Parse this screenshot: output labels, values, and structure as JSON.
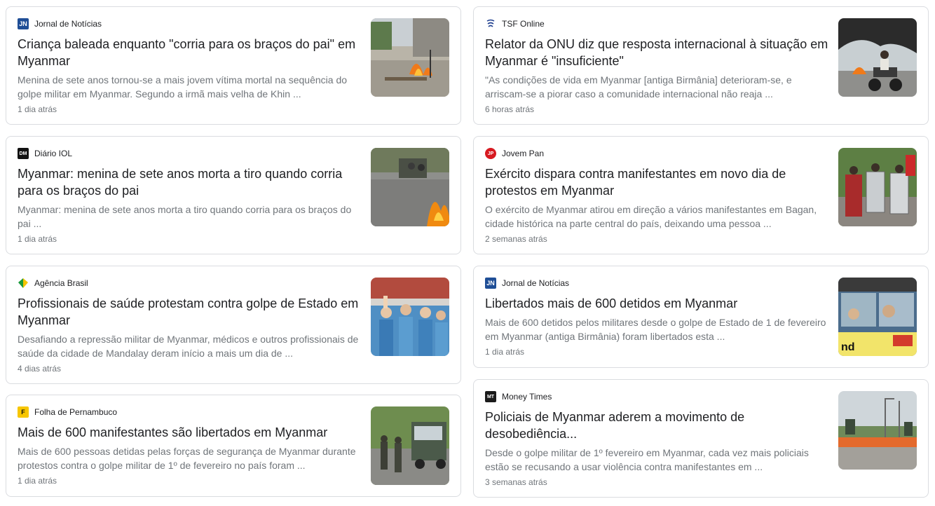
{
  "articles_left": [
    {
      "source": "Jornal de Notícias",
      "logo_text": "JN",
      "headline": "Criança baleada enquanto \"corria para os braços do pai\" em Myanmar",
      "snippet": "Menina de sete anos tornou-se a mais jovem vítima mortal na sequência do golpe militar em Myanmar. Segundo a irmã mais velha de Khin ...",
      "time": "1 dia atrás",
      "image_icon": "street-fire-photo"
    },
    {
      "source": "Diário IOL",
      "logo_text": "DM",
      "headline": "Myanmar: menina de sete anos morta a tiro quando corria para os braços do pai",
      "snippet": "Myanmar: menina de sete anos morta a tiro quando corria para os braços do pai ...",
      "time": "1 dia atrás",
      "image_icon": "street-burning-tire-photo"
    },
    {
      "source": "Agência Brasil",
      "logo_text": "",
      "headline": "Profissionais de saúde protestam contra golpe de Estado em Myanmar",
      "snippet": "Desafiando a repressão militar de Myanmar, médicos e outros profissionais de saúde da cidade de Mandalay deram início a mais um dia de ...",
      "time": "4 dias atrás",
      "image_icon": "health-workers-protest-photo"
    },
    {
      "source": "Folha de Pernambuco",
      "logo_text": "F",
      "headline": "Mais de 600 manifestantes são libertados em Myanmar",
      "snippet": "Mais de 600 pessoas detidas pelas forças de segurança de Myanmar durante protestos contra o golpe militar de 1º de fevereiro no país foram ...",
      "time": "1 dia atrás",
      "image_icon": "soldiers-truck-photo"
    }
  ],
  "articles_right": [
    {
      "source": "TSF Online",
      "logo_text": "",
      "headline": "Relator da ONU diz que resposta internacional à situação em Myanmar é \"insuficiente\"",
      "snippet": "\"As condições de vida em Myanmar [antiga Birmânia] deterioram-se, e arriscam-se a piorar caso a comunidade internacional não reaja ...",
      "time": "6 horas atrás",
      "image_icon": "motorbike-smoke-photo"
    },
    {
      "source": "Jovem Pan",
      "logo_text": "JP",
      "headline": "Exército dispara contra manifestantes em novo dia de protestos em Myanmar",
      "snippet": "O exército de Myanmar atirou em direção a vários manifestantes em Bagan, cidade histórica na parte central do país, deixando uma pessoa ...",
      "time": "2 semanas atrás",
      "image_icon": "protesters-shields-photo"
    },
    {
      "source": "Jornal de Notícias",
      "logo_text": "JN",
      "headline": "Libertados mais de 600 detidos em Myanmar",
      "snippet": "Mais de 600 detidos pelos militares desde o golpe de Estado de 1 de fevereiro em Myanmar (antiga Birmânia) foram libertados esta ...",
      "time": "1 dia atrás",
      "image_icon": "bus-window-photo"
    },
    {
      "source": "Money Times",
      "logo_text": "MT",
      "headline": "Policiais de Myanmar aderem a movimento de desobediência...",
      "snippet": "Desde o golpe militar de 1º fevereiro em Myanmar, cada vez mais policiais estão se recusando a usar violência contra manifestantes em ...",
      "time": "3 semanas atrás",
      "image_icon": "road-barricade-photo"
    }
  ],
  "colors": {
    "border": "#dadce0",
    "title": "#202124",
    "meta": "#70757a",
    "jn_blue": "#1f4e96",
    "jp_red": "#d71920",
    "folha_yellow": "#f7c600"
  }
}
